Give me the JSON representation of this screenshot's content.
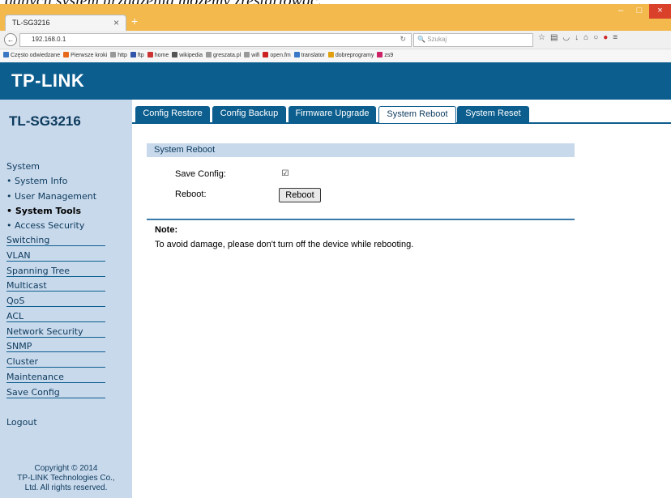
{
  "document": {
    "caption": "danych system urządzenia możemy zrestartować:"
  },
  "browser": {
    "tab_title": "TL-SG3216",
    "url": "192.168.0.1",
    "search_placeholder": "Szukaj",
    "bookmarks": [
      {
        "label": "Często odwiedzane",
        "color": "#3b78c4"
      },
      {
        "label": "Pierwsze kroki",
        "color": "#e8681a"
      },
      {
        "label": "http",
        "color": "#999999"
      },
      {
        "label": "ftp",
        "color": "#3355aa"
      },
      {
        "label": "home",
        "color": "#cc3333"
      },
      {
        "label": "wikipedia",
        "color": "#555555"
      },
      {
        "label": "greszata.pl",
        "color": "#999999"
      },
      {
        "label": "wifi",
        "color": "#999999"
      },
      {
        "label": "open.fm",
        "color": "#cc2222"
      },
      {
        "label": "translator",
        "color": "#3a78c8"
      },
      {
        "label": "dobreprogramy",
        "color": "#e0a010"
      },
      {
        "label": "zs9",
        "color": "#cc2266"
      }
    ]
  },
  "app": {
    "logo": "TP-LINK",
    "device_model": "TL-SG3216",
    "tabs": [
      {
        "label": "Config Restore",
        "active": false
      },
      {
        "label": "Config Backup",
        "active": false
      },
      {
        "label": "Firmware Upgrade",
        "active": false
      },
      {
        "label": "System Reboot",
        "active": true
      },
      {
        "label": "System Reset",
        "active": false
      }
    ],
    "sidebar": {
      "items": [
        {
          "label": "System",
          "type": "header"
        },
        {
          "label": "System Info",
          "type": "sub"
        },
        {
          "label": "User Management",
          "type": "sub"
        },
        {
          "label": "System Tools",
          "type": "sub-active"
        },
        {
          "label": "Access Security",
          "type": "sub"
        },
        {
          "label": "Switching",
          "type": "main"
        },
        {
          "label": "VLAN",
          "type": "main"
        },
        {
          "label": "Spanning Tree",
          "type": "main"
        },
        {
          "label": "Multicast",
          "type": "main"
        },
        {
          "label": "QoS",
          "type": "main"
        },
        {
          "label": "ACL",
          "type": "main"
        },
        {
          "label": "Network Security",
          "type": "main"
        },
        {
          "label": "SNMP",
          "type": "main"
        },
        {
          "label": "Cluster",
          "type": "main"
        },
        {
          "label": "Maintenance",
          "type": "main"
        },
        {
          "label": "Save Config",
          "type": "main"
        },
        {
          "label": "Logout",
          "type": "plain"
        }
      ],
      "copyright": [
        "Copyright © 2014",
        "TP-LINK Technologies Co.,",
        "Ltd. All rights reserved."
      ]
    },
    "reboot_panel": {
      "heading": "System Reboot",
      "save_config_label": "Save Config:",
      "save_config_checked": true,
      "reboot_label": "Reboot:",
      "reboot_button": "Reboot"
    },
    "note": {
      "title": "Note:",
      "text": "To avoid damage, please don't turn off the device while rebooting."
    }
  }
}
